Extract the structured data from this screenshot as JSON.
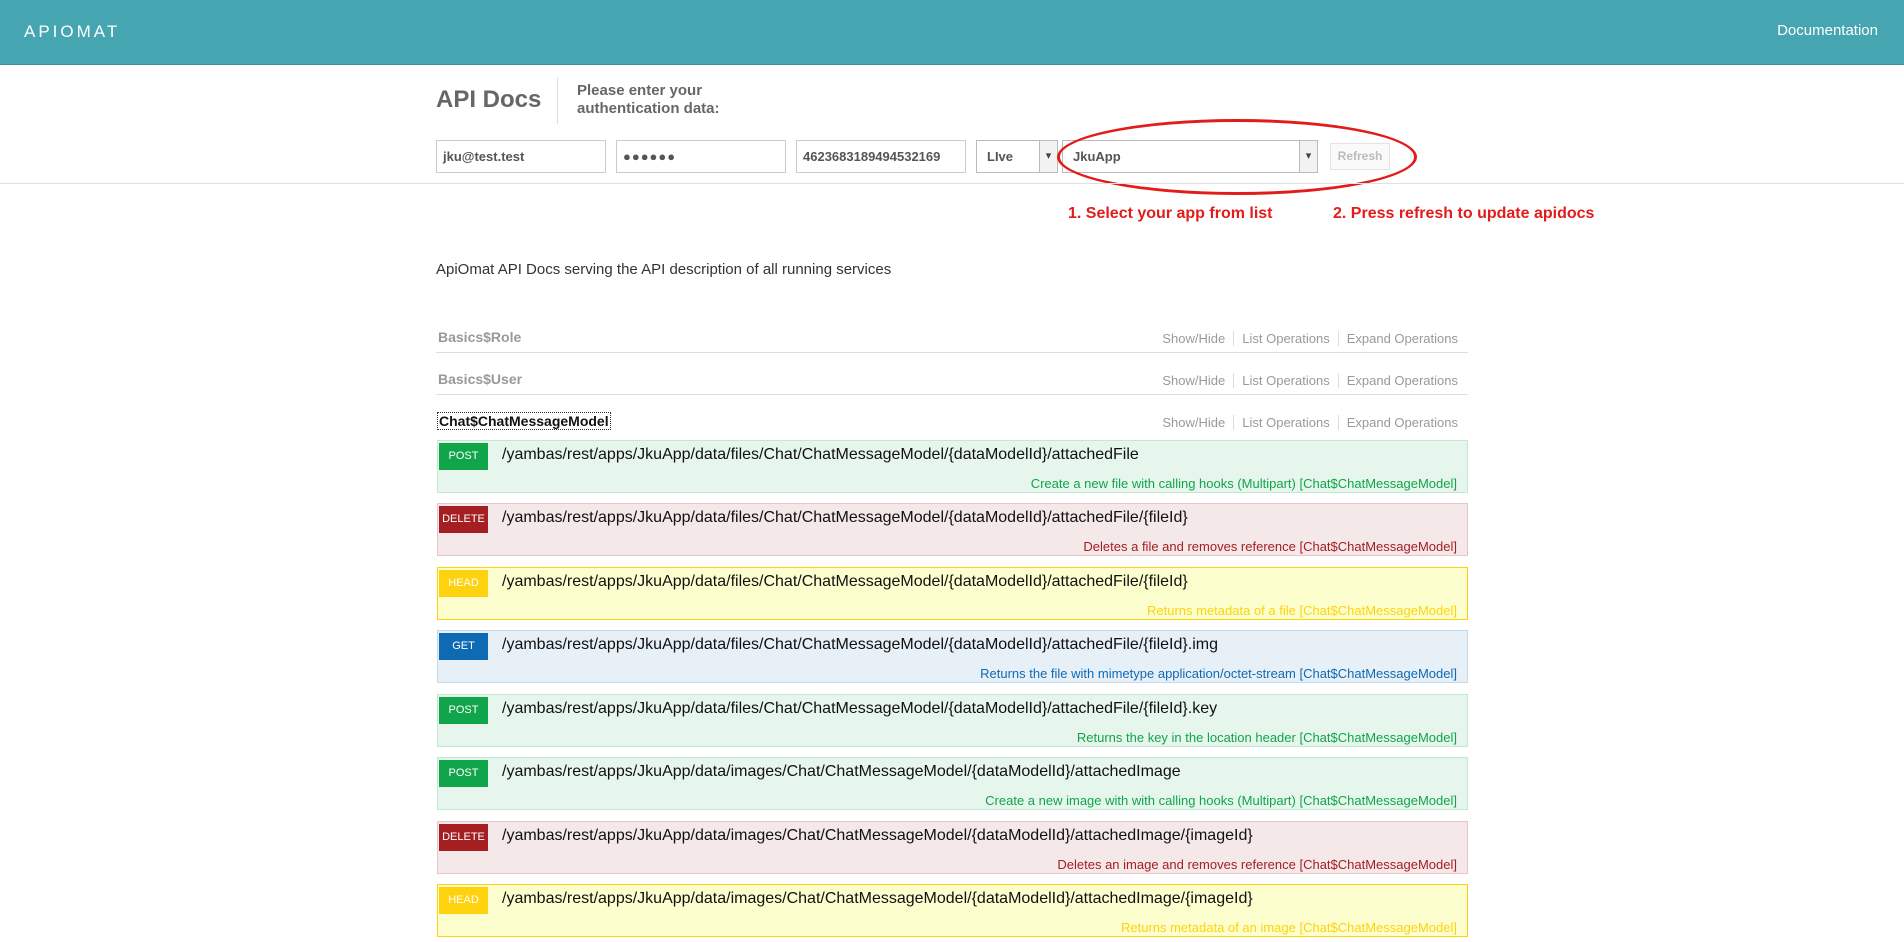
{
  "nav": {
    "logo_text": "APIOMAT",
    "documentation_label": "Documentation"
  },
  "header": {
    "title": "API Docs",
    "auth_prompt": "Please enter your authentication data:"
  },
  "auth": {
    "username": "jku@test.test",
    "password_mask": "●●●●●●",
    "api_key": "4623683189494532169",
    "system": "LIve",
    "app": "JkuApp",
    "refresh_label": "Refresh"
  },
  "hints": {
    "step1": "1. Select your app from list",
    "step2": "2. Press refresh to update apidocs"
  },
  "description": "ApiOmat API Docs serving the API description of all running services",
  "resource_actions": {
    "show_hide": "Show/Hide",
    "list_operations": "List Operations",
    "expand_operations": "Expand Operations"
  },
  "resources": [
    {
      "name": "Basics$Role"
    },
    {
      "name": "Basics$User"
    },
    {
      "name": "Chat$ChatMessageModel"
    }
  ],
  "operations": [
    {
      "method": "POST",
      "path": "/yambas/rest/apps/JkuApp/data/files/Chat/ChatMessageModel/{dataModelId}/attachedFile",
      "summary": "Create a new file with calling hooks (Multipart) [Chat$ChatMessageModel]"
    },
    {
      "method": "DELETE",
      "path": "/yambas/rest/apps/JkuApp/data/files/Chat/ChatMessageModel/{dataModelId}/attachedFile/{fileId}",
      "summary": "Deletes a file and removes reference [Chat$ChatMessageModel]"
    },
    {
      "method": "HEAD",
      "path": "/yambas/rest/apps/JkuApp/data/files/Chat/ChatMessageModel/{dataModelId}/attachedFile/{fileId}",
      "summary": "Returns metadata of a file [Chat$ChatMessageModel]"
    },
    {
      "method": "GET",
      "path": "/yambas/rest/apps/JkuApp/data/files/Chat/ChatMessageModel/{dataModelId}/attachedFile/{fileId}.img",
      "summary": "Returns the file with mimetype application/octet-stream [Chat$ChatMessageModel]"
    },
    {
      "method": "POST",
      "path": "/yambas/rest/apps/JkuApp/data/files/Chat/ChatMessageModel/{dataModelId}/attachedFile/{fileId}.key",
      "summary": "Returns the key in the location header [Chat$ChatMessageModel]"
    },
    {
      "method": "POST",
      "path": "/yambas/rest/apps/JkuApp/data/images/Chat/ChatMessageModel/{dataModelId}/attachedImage",
      "summary": "Create a new image with with calling hooks (Multipart) [Chat$ChatMessageModel]"
    },
    {
      "method": "DELETE",
      "path": "/yambas/rest/apps/JkuApp/data/images/Chat/ChatMessageModel/{dataModelId}/attachedImage/{imageId}",
      "summary": "Deletes an image and removes reference [Chat$ChatMessageModel]"
    },
    {
      "method": "HEAD",
      "path": "/yambas/rest/apps/JkuApp/data/images/Chat/ChatMessageModel/{dataModelId}/attachedImage/{imageId}",
      "summary": "Returns metadata of an image [Chat$ChatMessageModel]"
    }
  ],
  "colors": {
    "topbar": "#45a5b1",
    "post": "#10a54a",
    "delete": "#a41e22",
    "head": "#ffd20f",
    "get": "#0f6ab4",
    "annotation": "#e21b1b"
  }
}
